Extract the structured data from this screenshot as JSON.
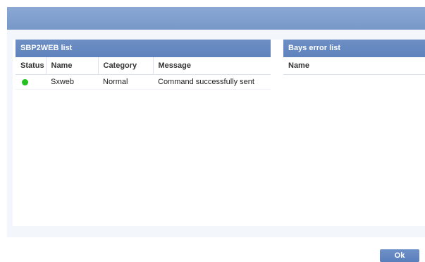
{
  "left_panel": {
    "title": "SBP2WEB list",
    "columns": [
      "Status",
      "Name",
      "Category",
      "Message"
    ],
    "rows": [
      {
        "status_color": "#22c11e",
        "name": "Sxweb",
        "category": "Normal",
        "message": "Command successfully sent"
      }
    ]
  },
  "right_panel": {
    "title": "Bays error list",
    "columns": [
      "Name"
    ]
  },
  "footer": {
    "ok_label": "Ok"
  },
  "colors": {
    "title_bar": "#7a9acb",
    "panel_header": "#6286bf",
    "status_ok": "#22c11e"
  }
}
